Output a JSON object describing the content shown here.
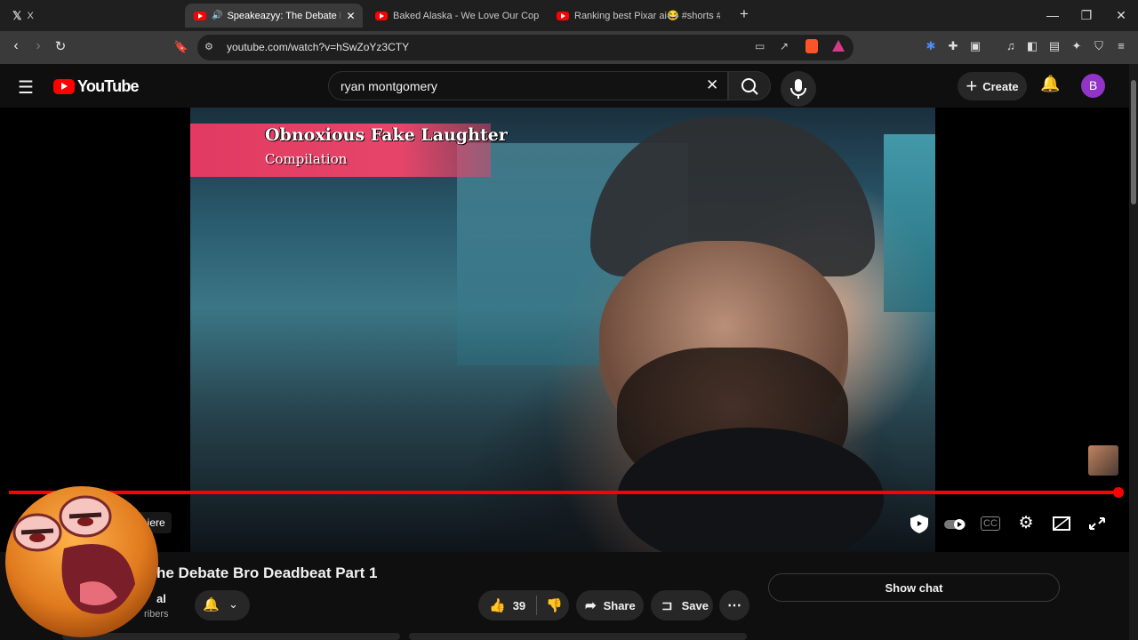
{
  "browser": {
    "tabs": [
      {
        "label": "X"
      },
      {
        "label": "Speakeazyy: The Debate Bro Deadbeat",
        "active": true
      },
      {
        "label": "Baked Alaska - We Love Our Cops [LIVE]"
      },
      {
        "label": "Ranking best Pixar ai😂 #shorts #pixar"
      }
    ],
    "new_tab": "+",
    "url": "youtube.com/watch?v=hSwZoYz3CTY"
  },
  "youtube": {
    "logo_text": "YouTube",
    "search_query": "ryan montgomery",
    "create_label": "Create",
    "avatar_letter": "B"
  },
  "video": {
    "banner_title": "Obnoxious Fake Laughter",
    "banner_subtitle": "Compilation",
    "premiere_label": "Premiere",
    "progress": 1.0,
    "title": "he Debate Bro Deadbeat Part 1",
    "channel_fragment": "al",
    "subscribers_fragment": "ribers",
    "like_count": "39",
    "share_label": "Share",
    "save_label": "Save",
    "show_chat_label": "Show chat"
  },
  "colors": {
    "accent": "#ff0000",
    "avatar": "#9334c9",
    "banner": "#e23a62"
  }
}
